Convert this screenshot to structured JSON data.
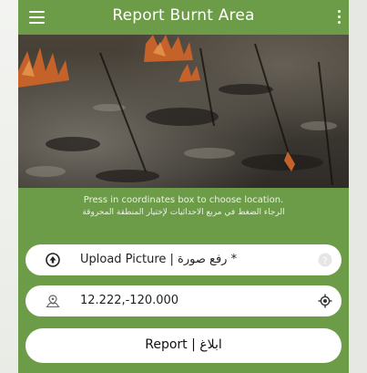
{
  "colors": {
    "brand_green": "#6d9c48",
    "field_bg": "#ffffff"
  },
  "app_bar": {
    "title": "Report Burnt Area",
    "menu_icon": "hamburger-menu-icon",
    "overflow_icon": "more-vertical-icon"
  },
  "photo": {
    "description_icon": "burnt-area-photo"
  },
  "instructions": {
    "english": "Press in coordinates box to choose location.",
    "arabic": "الرجاء الضغط في مربع الاحداثيات لإختيار المنطقة المحروقة"
  },
  "upload_field": {
    "label": "Upload Picture | رفع صورة *",
    "lead_icon": "upload-arrow-icon",
    "trail_icon": "help-icon"
  },
  "coords_field": {
    "value": "12.222,-120.000",
    "lead_icon": "location-area-icon",
    "trail_icon": "gps-locate-icon"
  },
  "report_button": {
    "label": "Report | ابلاغ"
  }
}
